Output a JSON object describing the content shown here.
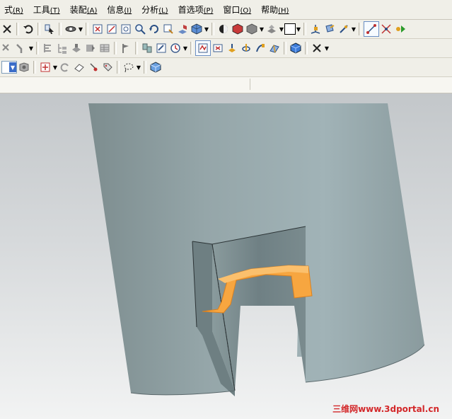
{
  "menu": {
    "items": [
      {
        "label": "式",
        "accel": "(R)"
      },
      {
        "label": "工具",
        "accel": "(T)"
      },
      {
        "label": "装配",
        "accel": "(A)"
      },
      {
        "label": "信息",
        "accel": "(I)"
      },
      {
        "label": "分析",
        "accel": "(L)"
      },
      {
        "label": "首选项",
        "accel": "(P)"
      },
      {
        "label": "窗口",
        "accel": "(O)"
      },
      {
        "label": "帮助",
        "accel": "(H)"
      }
    ]
  },
  "colors": {
    "model_body": "#8e9ea2",
    "highlight_feature": "#f7a640",
    "watermark": "#d3282a"
  },
  "watermark": {
    "text": "三维网www.3dportal.cn"
  }
}
